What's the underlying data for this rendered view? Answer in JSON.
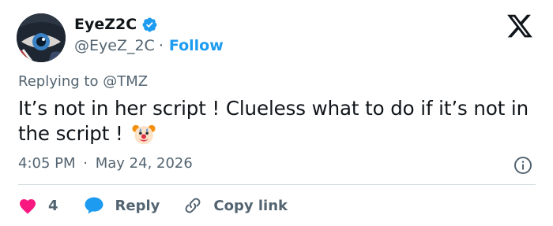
{
  "author": {
    "display_name": "EyeZ2C",
    "handle": "@EyeZ_2C",
    "separator": "·",
    "follow_label": "Follow"
  },
  "reply_context": {
    "prefix": "Replying to",
    "target": "@TMZ"
  },
  "tweet": {
    "text": "It’s not in her script ! Clueless what to do if it’s not in the script !",
    "emoji": "clown-face-icon"
  },
  "meta": {
    "time": "4:05 PM",
    "separator": "·",
    "date": "May 24, 2026"
  },
  "actions": {
    "like_count": "4",
    "reply_label": "Reply",
    "copy_label": "Copy link"
  },
  "colors": {
    "accent": "#1d9bf0",
    "like": "#f91880",
    "text": "#0f1419",
    "muted": "#536471",
    "divider": "#cfd9de"
  }
}
